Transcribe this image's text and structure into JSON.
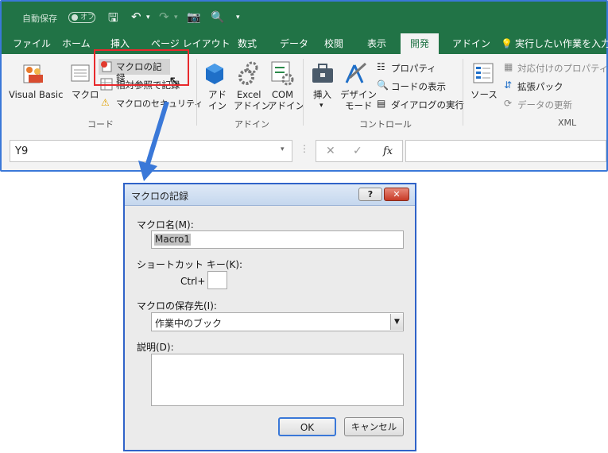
{
  "qat": {
    "autosave_label": "自動保存",
    "autosave_state": "オフ"
  },
  "tabs": [
    "ファイル",
    "ホーム",
    "挿入",
    "ページ レイアウト",
    "数式",
    "データ",
    "校閲",
    "表示",
    "開発",
    "アドイン"
  ],
  "tell_me": "実行したい作業を入力し",
  "ribbon": {
    "code": {
      "visual_basic": "Visual Basic",
      "macro": "マクロ",
      "record_macro": "マクロの記録",
      "relative_ref": "相対参照で記録",
      "macro_security": "マクロのセキュリティ",
      "group_label": "コード"
    },
    "addins": {
      "addin_l1": "アド",
      "addin_l2": "イン",
      "excel_l1": "Excel",
      "excel_l2": "アドイン",
      "com_l1": "COM",
      "com_l2": "アドイン",
      "group_label": "アドイン"
    },
    "controls": {
      "insert": "挿入",
      "design_l1": "デザイン",
      "design_l2": "モード",
      "properties": "プロパティ",
      "view_code": "コードの表示",
      "run_dialog": "ダイアログの実行",
      "group_label": "コントロール"
    },
    "xml": {
      "source": "ソース",
      "map_props": "対応付けのプロパティ",
      "expansion": "拡張パック",
      "refresh": "データの更新",
      "group_label": "XML"
    }
  },
  "formula_bar": {
    "name_box": "Y9",
    "fx": "fx"
  },
  "dialog": {
    "title": "マクロの記録",
    "macro_name_label": "マクロ名(M):",
    "macro_name_value": "Macro1",
    "shortcut_label": "ショートカット キー(K):",
    "ctrl_label": "Ctrl+",
    "shortcut_value": "",
    "store_label": "マクロの保存先(I):",
    "store_value": "作業中のブック",
    "desc_label": "説明(D):",
    "desc_value": "",
    "ok": "OK",
    "cancel": "キャンセル"
  },
  "colors": {
    "excel_green": "#217346",
    "frame_blue": "#3a78d8",
    "highlight_red": "#e8292c",
    "arrow_blue": "#3a78d8"
  }
}
